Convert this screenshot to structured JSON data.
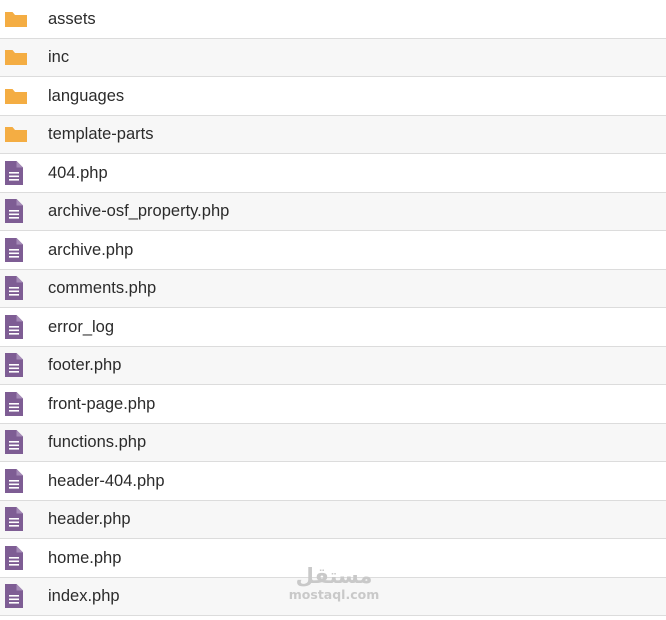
{
  "colors": {
    "folder": "#f4ad43",
    "file": "#7e5d94",
    "row_alt": "#f7f7f7",
    "divider": "#dcdcdc",
    "text": "#2b2b2b"
  },
  "items": [
    {
      "name": "assets",
      "icon": "folder-icon"
    },
    {
      "name": "inc",
      "icon": "folder-icon"
    },
    {
      "name": "languages",
      "icon": "folder-icon"
    },
    {
      "name": "template-parts",
      "icon": "folder-icon"
    },
    {
      "name": "404.php",
      "icon": "file-icon"
    },
    {
      "name": "archive-osf_property.php",
      "icon": "file-icon"
    },
    {
      "name": "archive.php",
      "icon": "file-icon"
    },
    {
      "name": "comments.php",
      "icon": "file-icon"
    },
    {
      "name": "error_log",
      "icon": "file-icon"
    },
    {
      "name": "footer.php",
      "icon": "file-icon"
    },
    {
      "name": "front-page.php",
      "icon": "file-icon"
    },
    {
      "name": "functions.php",
      "icon": "file-icon"
    },
    {
      "name": "header-404.php",
      "icon": "file-icon"
    },
    {
      "name": "header.php",
      "icon": "file-icon"
    },
    {
      "name": "home.php",
      "icon": "file-icon"
    },
    {
      "name": "index.php",
      "icon": "file-icon"
    }
  ],
  "watermark": {
    "logo": "مستقل",
    "url": "mostaql.com"
  }
}
